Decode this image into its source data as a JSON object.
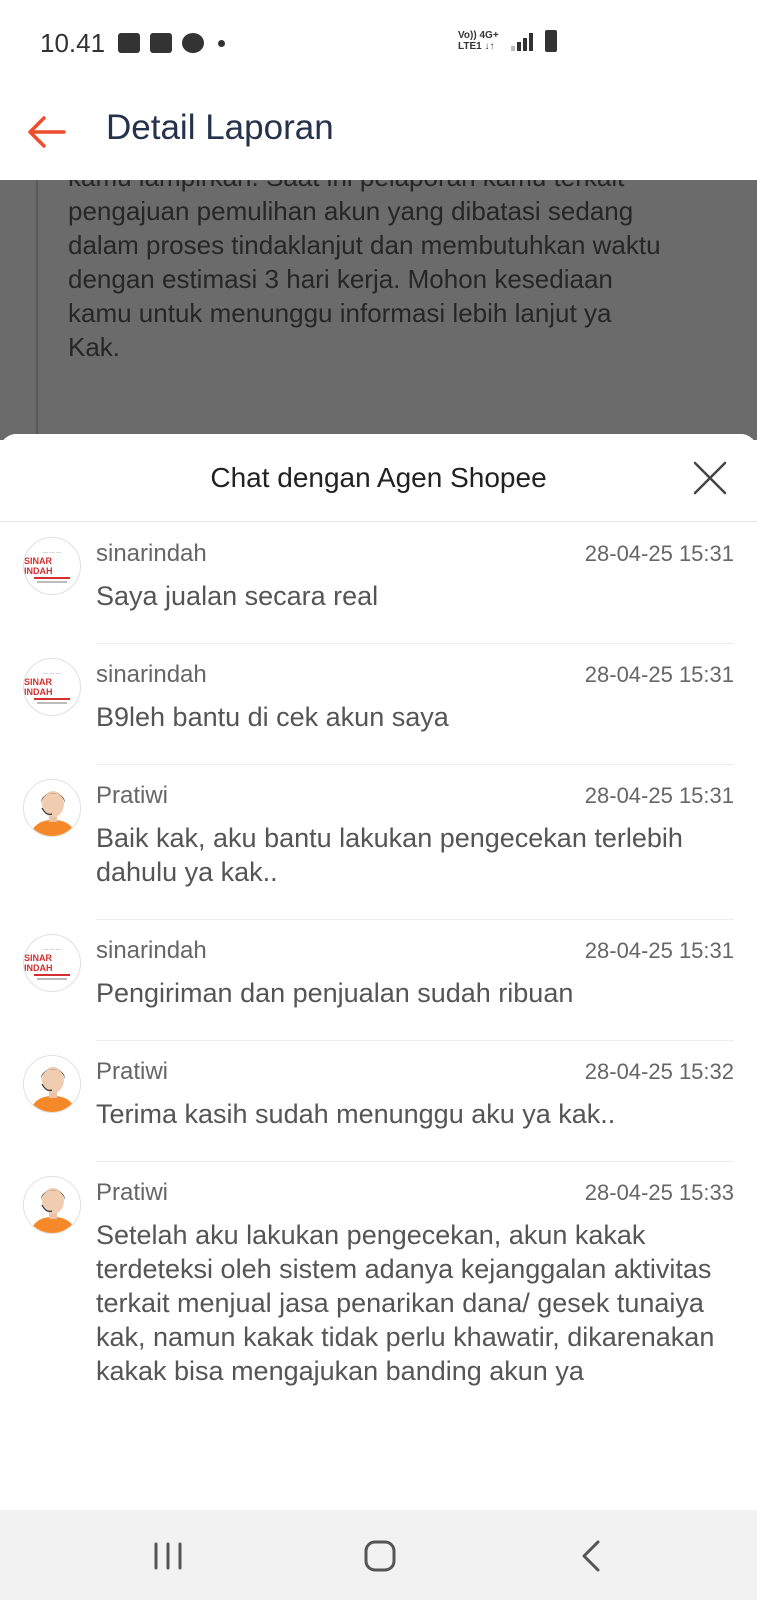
{
  "status_bar": {
    "time": "10.41",
    "network_top": "Vo)) 4G+",
    "network_bottom": "LTE1 ↓↑"
  },
  "header": {
    "title": "Detail Laporan"
  },
  "report_text": "kamu lampirkan. Saat ini pelaporan kamu terkait\npengajuan pemulihan akun yang dibatasi sedang\ndalam proses tindaklanjut dan membutuhkan waktu\ndengan estimasi 3 hari kerja. Mohon kesediaan\nkamu untuk menunggu informasi lebih lanjut ya\nKak.",
  "chat": {
    "title": "Chat dengan Agen Shopee",
    "shop_logo_text": "SINAR INDAH",
    "messages": [
      {
        "sender": "sinarindah",
        "avatar": "shop-logo",
        "time": "28-04-25 15:31",
        "text": "Saya jualan secara real"
      },
      {
        "sender": "sinarindah",
        "avatar": "shop-logo",
        "time": "28-04-25 15:31",
        "text": "B9leh bantu di cek akun saya"
      },
      {
        "sender": "Pratiwi",
        "avatar": "agent",
        "time": "28-04-25 15:31",
        "text": "Baik kak, aku bantu lakukan pengecekan terlebih dahulu ya kak.."
      },
      {
        "sender": "sinarindah",
        "avatar": "shop-logo",
        "time": "28-04-25 15:31",
        "text": "Pengiriman dan penjualan sudah ribuan"
      },
      {
        "sender": "Pratiwi",
        "avatar": "agent",
        "time": "28-04-25 15:32",
        "text": "Terima kasih sudah menunggu aku ya kak.."
      },
      {
        "sender": "Pratiwi",
        "avatar": "agent",
        "time": "28-04-25 15:33",
        "text": "Setelah aku lakukan pengecekan, akun kakak terdeteksi oleh sistem adanya kejanggalan aktivitas terkait menjual jasa penarikan dana/ gesek tunaiya kak, namun kakak tidak perlu khawatir, dikarenakan kakak bisa mengajukan banding akun ya"
      }
    ]
  },
  "colors": {
    "accent": "#ee4d2d",
    "title": "#25324b",
    "agent_shirt": "#f5892a"
  }
}
